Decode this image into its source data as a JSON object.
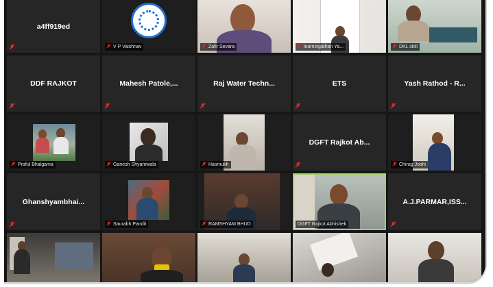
{
  "meeting": {
    "participants": [
      {
        "name": "a4ff919ed",
        "display": "avatar-text",
        "video": false,
        "muted": true
      },
      {
        "name": "V P Vaishnav",
        "display": "logo",
        "video": true,
        "muted": true
      },
      {
        "name": "Zafir Sevara",
        "display": "camera",
        "video": true,
        "muted": true
      },
      {
        "name": "learningathan Ya...",
        "display": "camera",
        "video": true,
        "muted": true
      },
      {
        "name": "DKL skill",
        "display": "camera",
        "video": true,
        "muted": true
      },
      {
        "name": "DDF RAJKOT",
        "display": "avatar-text",
        "video": false,
        "muted": true
      },
      {
        "name": "Mahesh  Patole,...",
        "display": "avatar-text",
        "video": false,
        "muted": true
      },
      {
        "name": "Raj Water Techn...",
        "display": "avatar-text",
        "video": false,
        "muted": true
      },
      {
        "name": "ETS",
        "display": "avatar-text",
        "video": false,
        "muted": true
      },
      {
        "name": "Yash Rathod - R...",
        "display": "avatar-text",
        "video": false,
        "muted": true
      },
      {
        "name": "Praful Bhalgama",
        "display": "photo",
        "video": true,
        "muted": true
      },
      {
        "name": "Ganesh Shyamwala",
        "display": "photo",
        "video": true,
        "muted": true
      },
      {
        "name": "Hasmukh",
        "display": "camera",
        "video": true,
        "muted": true
      },
      {
        "name": "DGFT Rajkot Ab...",
        "display": "avatar-text",
        "video": false,
        "muted": true
      },
      {
        "name": "Chirag Joshi",
        "display": "camera",
        "video": true,
        "muted": true
      },
      {
        "name": "Ghanshyambhai...",
        "display": "avatar-text",
        "video": false,
        "muted": true
      },
      {
        "name": "Saurabh Pandit",
        "display": "photo",
        "video": true,
        "muted": true
      },
      {
        "name": "RAMSHYAM BHUD",
        "display": "camera",
        "video": true,
        "muted": true
      },
      {
        "name": "DGFT Rajkot Abhishek",
        "display": "camera",
        "video": true,
        "muted": false,
        "active": true
      },
      {
        "name": "A.J.PARMAR,ISS...",
        "display": "avatar-text",
        "video": false,
        "muted": true
      },
      {
        "name": "",
        "display": "camera",
        "video": true,
        "muted": false
      },
      {
        "name": "",
        "display": "camera",
        "video": true,
        "muted": false
      },
      {
        "name": "",
        "display": "camera",
        "video": true,
        "muted": false
      },
      {
        "name": "",
        "display": "camera",
        "video": true,
        "muted": false
      },
      {
        "name": "",
        "display": "camera",
        "video": true,
        "muted": false
      }
    ]
  },
  "colors": {
    "tile_bg": "#262626",
    "frame_bg": "#161616",
    "active_border": "#9bd35a",
    "mute_red": "#e02828"
  },
  "icons": {
    "mute": "microphone-muted-icon"
  }
}
